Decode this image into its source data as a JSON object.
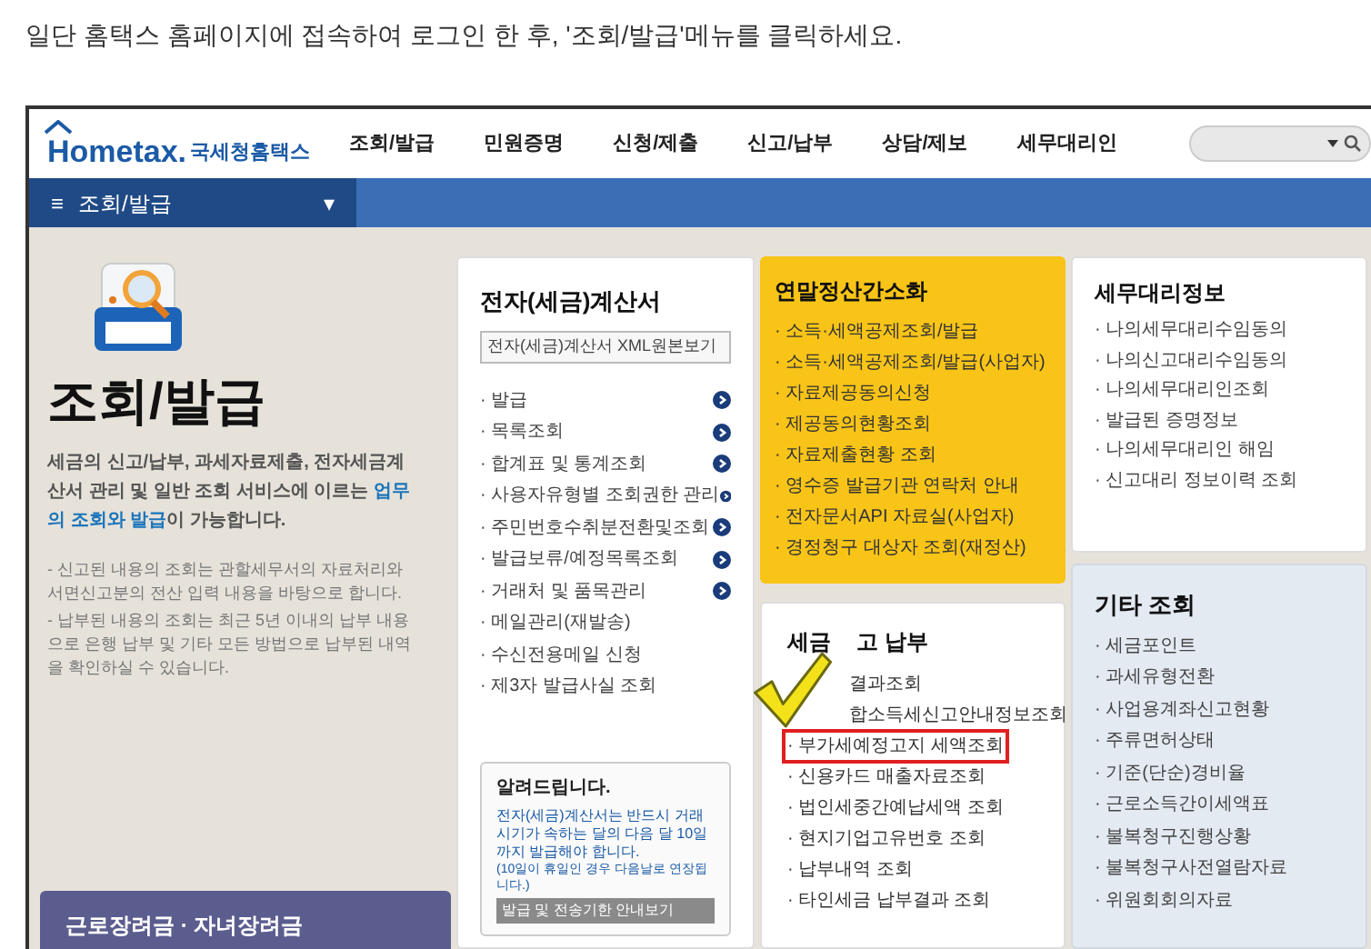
{
  "intro": "일단 홈택스 홈페이지에 접속하여 로그인 한 후, '조회/발급'메뉴를 클릭하세요.",
  "header": {
    "logo_word": "Hometax.",
    "logo_sub": "국세청홈택스",
    "nav": [
      "조회/발급",
      "민원증명",
      "신청/제출",
      "신고/납부",
      "상담/제보",
      "세무대리인"
    ]
  },
  "breadcrumb": {
    "menu_glyph": "≡",
    "label": "조회/발급",
    "caret": "▾"
  },
  "intro_panel": {
    "title": "조회/발급",
    "description": "세금의 신고/납부, 과세자료제출, 전자세금계산서 관리 및 일반 조회 서비스에 이르는 **업무의 조회와 발급**이 가능합니다.",
    "notes": [
      "- 신고된 내용의 조회는 관할세무서의 자료처리와 서면신고분의 전산 입력 내용을 바탕으로 합니다.",
      "- 납부된 내용의 조회는 최근 5년 이내의 납부 내용으로 은행 납부 및 기타 모든 방법으로 납부된 내역을 확인하실 수 있습니다."
    ],
    "banner": "근로장려금 · 자녀장려금"
  },
  "invoice_panel": {
    "title": "전자(세금)계산서",
    "xml_button": "전자(세금)계산서 XML원본보기",
    "items": [
      {
        "label": "· 발급",
        "link": true
      },
      {
        "label": "· 목록조회",
        "link": true
      },
      {
        "label": "· 합계표 및 통계조회",
        "link": true
      },
      {
        "label": "· 사용자유형별 조회권한 관리",
        "link": true
      },
      {
        "label": "· 주민번호수취분전환및조회",
        "link": true
      },
      {
        "label": "· 발급보류/예정목록조회",
        "link": true
      },
      {
        "label": "· 거래처 및 품목관리",
        "link": true
      },
      {
        "label": "· 메일관리(재발송)",
        "link": false
      },
      {
        "label": "· 수신전용메일 신청",
        "link": false
      },
      {
        "label": "· 제3자 발급사실 조회",
        "link": false
      }
    ],
    "notice": {
      "title": "알려드립니다.",
      "text": "전자(세금)계산서는 반드시 거래시기가 속하는 달의 다음 달 10일까지 발급해야 합니다.",
      "sub": "(10일이 휴일인 경우 다음날로 연장됩니다.)",
      "button": "발급 및 전송기한 안내보기"
    }
  },
  "yearend_panel": {
    "title": "연말정산간소화",
    "items": [
      "· 소득·세액공제조회/발급",
      "· 소득·세액공제조회/발급(사업자)",
      "· 자료제공동의신청",
      "· 제공동의현황조회",
      "· 자료제출현황 조회",
      "· 영수증 발급기관 연락처 안내",
      "· 전자문서API 자료실(사업자)",
      "· 경정청구 대상자 조회(재정산)"
    ]
  },
  "tax_panel": {
    "title_before": "세금",
    "title_after": "고 납부",
    "items": [
      {
        "label": "결과조회",
        "kind": "covered",
        "highlighted": false
      },
      {
        "label": "합소득세신고안내정보조회",
        "kind": "covered",
        "highlighted": false
      },
      {
        "label": "· 부가세예정고지 세액조회",
        "kind": "item",
        "highlighted": true
      },
      {
        "label": "· 신용카드 매출자료조회",
        "kind": "item",
        "highlighted": false
      },
      {
        "label": "· 법인세중간예납세액 조회",
        "kind": "item",
        "highlighted": false
      },
      {
        "label": "· 현지기업고유번호 조회",
        "kind": "item",
        "highlighted": false
      },
      {
        "label": "· 납부내역 조회",
        "kind": "item",
        "highlighted": false
      },
      {
        "label": "· 타인세금 납부결과 조회",
        "kind": "item",
        "highlighted": false
      }
    ]
  },
  "agent_panel": {
    "title": "세무대리정보",
    "items": [
      "· 나의세무대리수임동의",
      "· 나의신고대리수임동의",
      "· 나의세무대리인조회",
      "· 발급된 증명정보",
      "· 나의세무대리인 해임",
      "· 신고대리 정보이력 조회"
    ]
  },
  "other_panel": {
    "title": "기타 조회",
    "items": [
      "· 세금포인트",
      "· 과세유형전환",
      "· 사업용계좌신고현황",
      "· 주류면허상태",
      "· 기준(단순)경비율",
      "· 근로소득간이세액표",
      "· 불복청구진행상황",
      "· 불복청구사전열람자료",
      "· 위원회회의자료"
    ]
  }
}
